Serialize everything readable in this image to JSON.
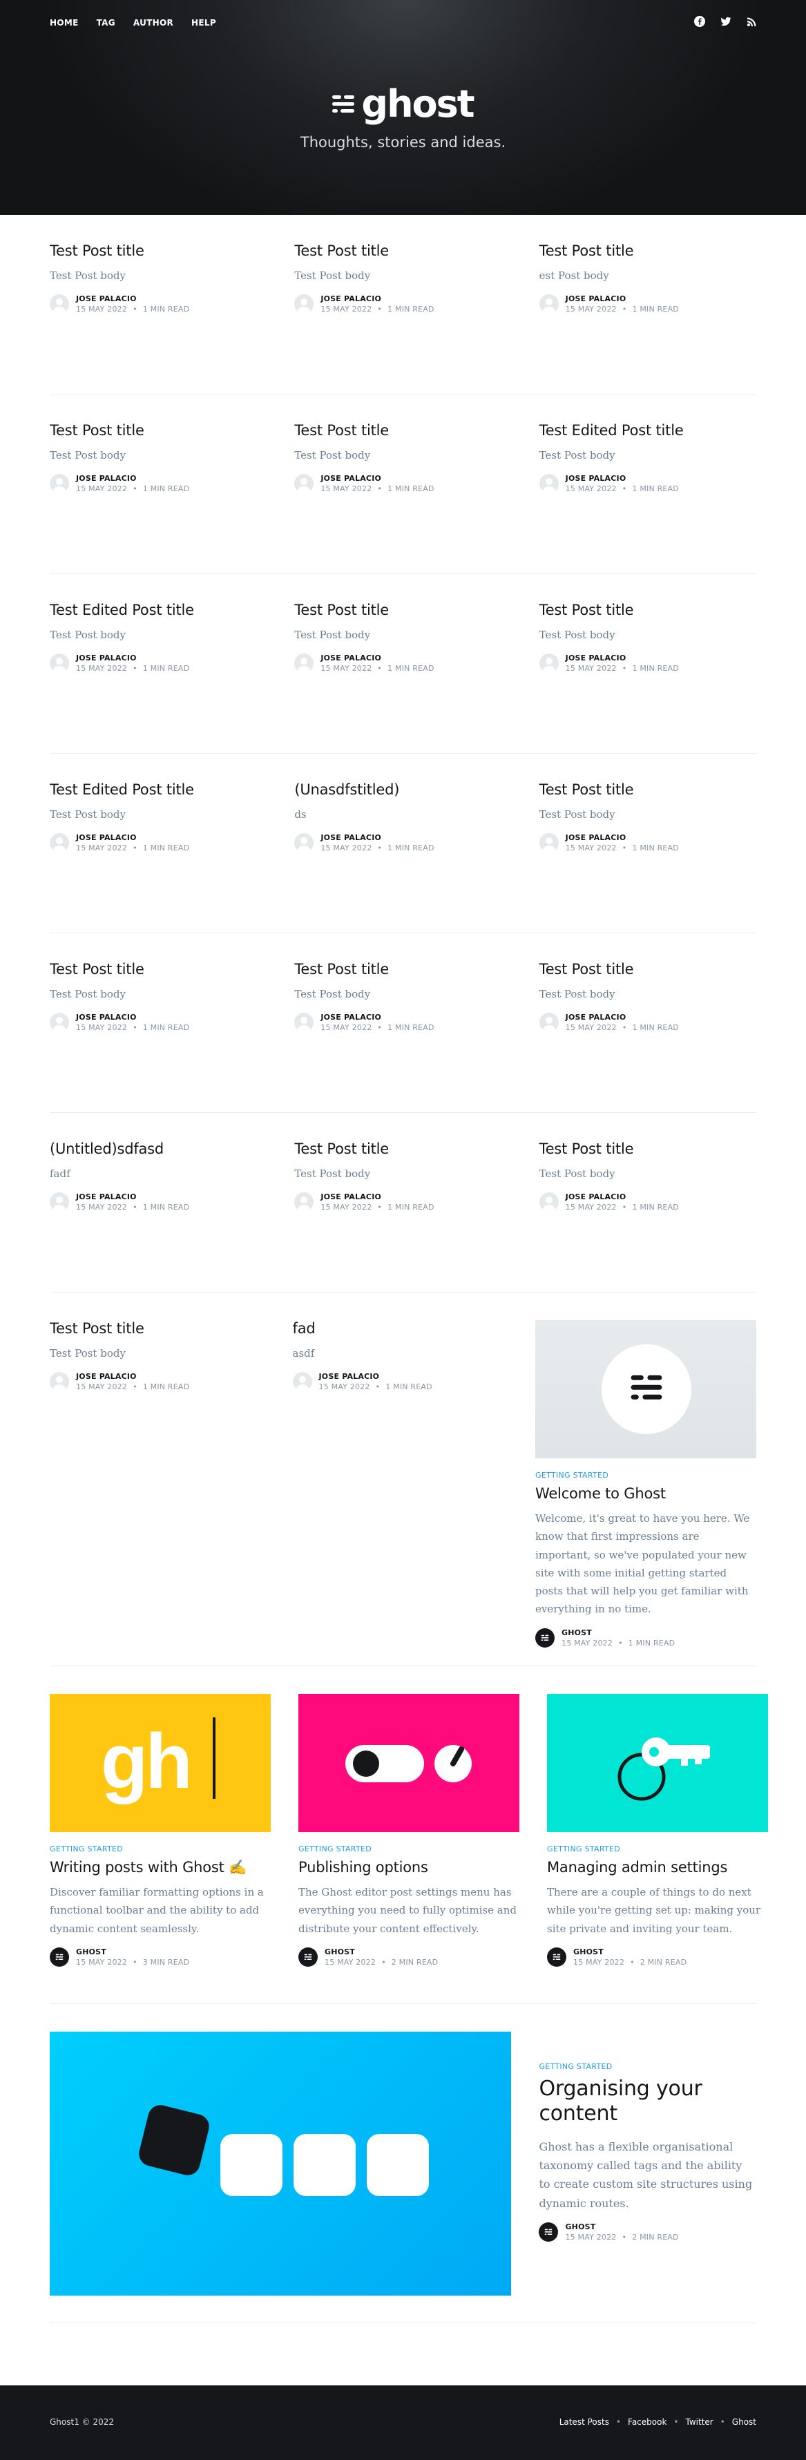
{
  "header": {
    "nav": [
      "HOME",
      "TAG",
      "AUTHOR",
      "HELP"
    ],
    "social": [
      "facebook-icon",
      "twitter-icon",
      "rss-icon"
    ],
    "brand": "ghost",
    "tagline": "Thoughts, stories and ideas."
  },
  "rows": [
    [
      {
        "title": "Test Post title",
        "excerpt": "Test Post body",
        "author": "JOSE PALACIO",
        "date": "15 MAY 2022",
        "read": "1 MIN READ"
      },
      {
        "title": "Test Post title",
        "excerpt": "Test Post body",
        "author": "JOSE PALACIO",
        "date": "15 MAY 2022",
        "read": "1 MIN READ"
      },
      {
        "title": "Test Post title",
        "excerpt": "est Post body",
        "author": "JOSE PALACIO",
        "date": "15 MAY 2022",
        "read": "1 MIN READ"
      }
    ],
    [
      {
        "title": "Test Post title",
        "excerpt": "Test Post body",
        "author": "JOSE PALACIO",
        "date": "15 MAY 2022",
        "read": "1 MIN READ"
      },
      {
        "title": "Test Post title",
        "excerpt": "Test Post body",
        "author": "JOSE PALACIO",
        "date": "15 MAY 2022",
        "read": "1 MIN READ"
      },
      {
        "title": "Test Edited Post title",
        "excerpt": "Test Post body",
        "author": "JOSE PALACIO",
        "date": "15 MAY 2022",
        "read": "1 MIN READ"
      }
    ],
    [
      {
        "title": "Test Edited Post title",
        "excerpt": "Test Post body",
        "author": "JOSE PALACIO",
        "date": "15 MAY 2022",
        "read": "1 MIN READ"
      },
      {
        "title": "Test Post title",
        "excerpt": "Test Post body",
        "author": "JOSE PALACIO",
        "date": "15 MAY 2022",
        "read": "1 MIN READ"
      },
      {
        "title": "Test Post title",
        "excerpt": "Test Post body",
        "author": "JOSE PALACIO",
        "date": "15 MAY 2022",
        "read": "1 MIN READ"
      }
    ],
    [
      {
        "title": "Test Edited Post title",
        "excerpt": "Test Post body",
        "author": "JOSE PALACIO",
        "date": "15 MAY 2022",
        "read": "1 MIN READ"
      },
      {
        "title": "(Unasdfstitled)",
        "excerpt": "ds",
        "author": "JOSE PALACIO",
        "date": "15 MAY 2022",
        "read": "1 MIN READ"
      },
      {
        "title": "Test Post title",
        "excerpt": "Test Post body",
        "author": "JOSE PALACIO",
        "date": "15 MAY 2022",
        "read": "1 MIN READ"
      }
    ],
    [
      {
        "title": "Test Post title",
        "excerpt": "Test Post body",
        "author": "JOSE PALACIO",
        "date": "15 MAY 2022",
        "read": "1 MIN READ"
      },
      {
        "title": "Test Post title",
        "excerpt": "Test Post body",
        "author": "JOSE PALACIO",
        "date": "15 MAY 2022",
        "read": "1 MIN READ"
      },
      {
        "title": "Test Post title",
        "excerpt": "Test Post body",
        "author": "JOSE PALACIO",
        "date": "15 MAY 2022",
        "read": "1 MIN READ"
      }
    ],
    [
      {
        "title": "(Untitled)sdfasd",
        "excerpt": "fadf",
        "author": "JOSE PALACIO",
        "date": "15 MAY 2022",
        "read": "1 MIN READ"
      },
      {
        "title": "Test Post title",
        "excerpt": "Test Post body",
        "author": "JOSE PALACIO",
        "date": "15 MAY 2022",
        "read": "1 MIN READ"
      },
      {
        "title": "Test Post title",
        "excerpt": "Test Post body",
        "author": "JOSE PALACIO",
        "date": "15 MAY 2022",
        "read": "1 MIN READ"
      }
    ]
  ],
  "row7": [
    {
      "title": "Test Post title",
      "excerpt": "Test Post body",
      "author": "JOSE PALACIO",
      "date": "15 MAY 2022",
      "read": "1 MIN READ"
    },
    {
      "title": "fad",
      "excerpt": "asdf",
      "author": "JOSE PALACIO",
      "date": "15 MAY 2022",
      "read": "1 MIN READ"
    },
    {
      "tag": "GETTING STARTED",
      "title": "Welcome to Ghost",
      "excerpt": "Welcome, it's great to have you here. We know that first impressions are important, so we've populated your new site with some initial getting started posts that will help you get familiar with everything in no time.",
      "author": "GHOST",
      "date": "15 MAY 2022",
      "read": "1 MIN READ"
    }
  ],
  "row8": [
    {
      "tag": "GETTING STARTED",
      "title": "Writing posts with Ghost ✍️",
      "excerpt": "Discover familiar formatting options in a functional toolbar and the ability to add dynamic content seamlessly.",
      "author": "GHOST",
      "date": "15 MAY 2022",
      "read": "3 MIN READ",
      "image_text": "gh"
    },
    {
      "tag": "GETTING STARTED",
      "title": "Publishing options",
      "excerpt": "The Ghost editor post settings menu has everything you need to fully optimise and distribute your content effectively.",
      "author": "GHOST",
      "date": "15 MAY 2022",
      "read": "2 MIN READ"
    },
    {
      "tag": "GETTING STARTED",
      "title": "Managing admin settings",
      "excerpt": "There are a couple of things to do next while you're getting set up: making your site private and inviting your team.",
      "author": "GHOST",
      "date": "15 MAY 2022",
      "read": "2 MIN READ"
    }
  ],
  "big": {
    "tag": "GETTING STARTED",
    "title": "Organising your content",
    "excerpt": "Ghost has a flexible organisational taxonomy called tags and the ability to create custom site structures using dynamic routes.",
    "author": "GHOST",
    "date": "15 MAY 2022",
    "read": "2 MIN READ"
  },
  "footer": {
    "copy": "Ghost1 © 2022",
    "links": [
      "Latest Posts",
      "Facebook",
      "Twitter",
      "Ghost"
    ]
  },
  "colors": {
    "header_bg": "#1f2124",
    "accent": "#1d9ef0",
    "excerpt": "#6b7f91",
    "footer_bg": "#15171a"
  }
}
